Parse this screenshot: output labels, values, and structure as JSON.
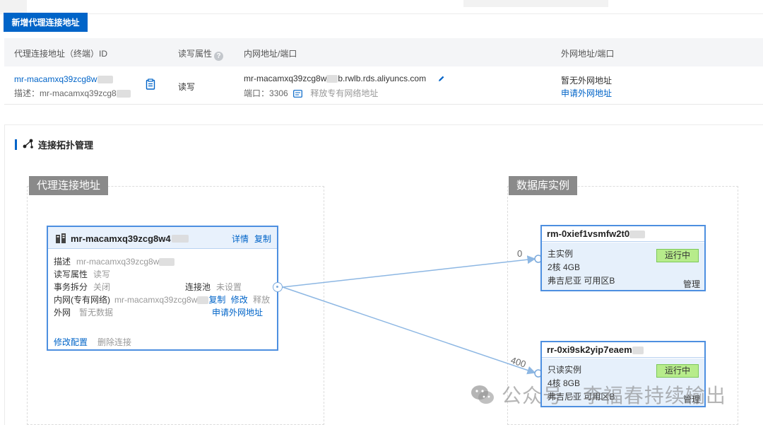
{
  "toolbar": {
    "add_button": "新增代理连接地址"
  },
  "table": {
    "columns": [
      "代理连接地址（终端）ID",
      "读写属性",
      "内网地址/端口",
      "外网地址/端口"
    ],
    "row": {
      "id": "mr-macamxq39zcg8w",
      "desc_label": "描述：",
      "desc_value": "mr-macamxq39zcg8",
      "rw": "读写",
      "intranet_prefix": "mr-macamxq39zcg8w",
      "intranet_suffix": "b.rwlb.rds.aliyuncs.com",
      "port_label": "端口：",
      "port_value": "3306",
      "release_link": "释放专有网络地址",
      "public_none": "暂无外网地址",
      "apply_public": "申请外网地址"
    }
  },
  "topology": {
    "title": "连接拓扑管理",
    "proxy_group_label": "代理连接地址",
    "db_group_label": "数据库实例",
    "proxy_node": {
      "name": "mr-macamxq39zcg8w4",
      "detail": "详情",
      "copy": "复制",
      "fields": {
        "desc_k": "描述",
        "desc_v": "mr-macamxq39zcg8w",
        "rw_k": "读写属性",
        "rw_v": "读写",
        "split_k": "事务拆分",
        "split_v": "关闭",
        "pool_k": "连接池",
        "pool_v": "未设置",
        "vpc_k": "内网(专有网络)",
        "vpc_v": "mr-macamxq39zcg8w",
        "vpc_copy": "复制",
        "vpc_edit": "修改",
        "vpc_release": "释放",
        "public_k": "外网",
        "public_v": "暂无数据",
        "public_apply": "申请外网地址"
      },
      "modify": "修改配置",
      "delete": "删除连接"
    },
    "edges": [
      {
        "weight": "0"
      },
      {
        "weight": "400"
      }
    ],
    "db_primary": {
      "name": "rm-0xief1vsmfw2t0",
      "role": "主实例",
      "spec": "2核 4GB",
      "zone": "弗吉尼亚 可用区B",
      "status": "运行中",
      "manage": "管理"
    },
    "db_readonly": {
      "name": "rr-0xi9sk2yip7eaem",
      "role": "只读实例",
      "spec": "4核 8GB",
      "zone": "弗吉尼亚 可用区B",
      "status": "运行中",
      "manage": "管理"
    }
  },
  "watermark": "公众号 · 李福春持续输出",
  "colors": {
    "primary": "#0064c8",
    "status_green": "#b7ec8b",
    "edge": "#8db7e3"
  }
}
